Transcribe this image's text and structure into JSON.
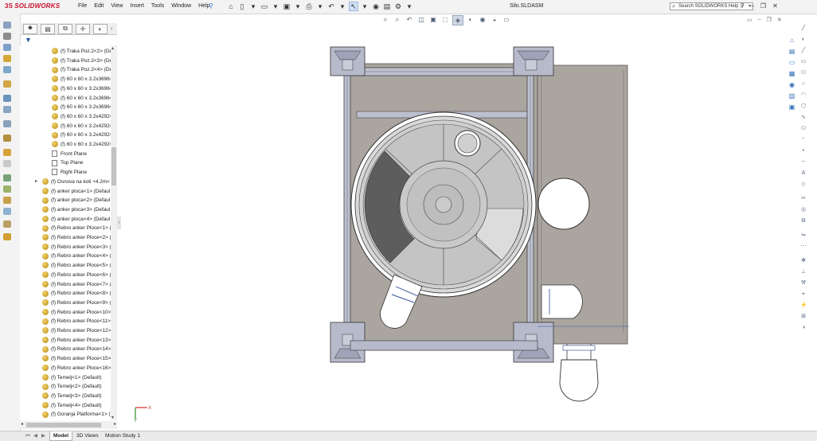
{
  "app": {
    "logo_text": "SOLIDWORKS",
    "logo_mark": "3S",
    "document_title": "Silo.SLDASM"
  },
  "menu": [
    "File",
    "Edit",
    "View",
    "Insert",
    "Tools",
    "Window",
    "Help"
  ],
  "search": {
    "placeholder": "Search SOLIDWORKS Help"
  },
  "feature_tree": {
    "items": [
      {
        "label": "(f) Traka Poz.2<2> (De",
        "kind": "part"
      },
      {
        "label": "(f) Traka Poz.2<3> (De",
        "kind": "part"
      },
      {
        "label": "(f) Traka Poz.2<4> (De",
        "kind": "part"
      },
      {
        "label": "(f) 60 x 60 x 3.2x3696<",
        "kind": "part"
      },
      {
        "label": "(f) 60 x 60 x 3.2x3696<",
        "kind": "part"
      },
      {
        "label": "(f) 60 x 60 x 3.2x3696<",
        "kind": "part"
      },
      {
        "label": "(f) 60 x 60 x 3.2x3696<",
        "kind": "part"
      },
      {
        "label": "(f) 60 x 60 x 3.2x4292<",
        "kind": "part"
      },
      {
        "label": "(f) 60 x 60 x 3.2x4292<",
        "kind": "part"
      },
      {
        "label": "(f) 60 x 60 x 3.2x4292<",
        "kind": "part"
      },
      {
        "label": "(f) 60 x 60 x 3.2x4292<",
        "kind": "part"
      },
      {
        "label": "Front Plane",
        "kind": "plane"
      },
      {
        "label": "Top Plane",
        "kind": "plane"
      },
      {
        "label": "Right Plane",
        "kind": "plane"
      },
      {
        "label": "(f) Osnova na koti +4.2m<",
        "kind": "assembly"
      },
      {
        "label": "(f) anker ploca<1> (Defaul",
        "kind": "part"
      },
      {
        "label": "(f) anker ploca<2> (Defaul",
        "kind": "part"
      },
      {
        "label": "(f) anker ploca<3> (Defaul",
        "kind": "part"
      },
      {
        "label": "(f) anker ploca<4> (Defaul",
        "kind": "part"
      },
      {
        "label": "(f) Rebro anker Ploce<1> (",
        "kind": "part"
      },
      {
        "label": "(f) Rebro anker Ploce<2> (",
        "kind": "part"
      },
      {
        "label": "(f) Rebro anker Ploce<3> (",
        "kind": "part"
      },
      {
        "label": "(f) Rebro anker Ploce<4> (",
        "kind": "part"
      },
      {
        "label": "(f) Rebro anker Ploce<5> (",
        "kind": "part"
      },
      {
        "label": "(f) Rebro anker Ploce<6> (",
        "kind": "part"
      },
      {
        "label": "(f) Rebro anker Ploce<7> (",
        "kind": "part"
      },
      {
        "label": "(f) Rebro anker Ploce<8> (",
        "kind": "part"
      },
      {
        "label": "(f) Rebro anker Ploce<9> (",
        "kind": "part"
      },
      {
        "label": "(f) Rebro anker Ploce<10>",
        "kind": "part"
      },
      {
        "label": "(f) Rebro anker Ploce<11>",
        "kind": "part"
      },
      {
        "label": "(f) Rebro anker Ploce<12>",
        "kind": "part"
      },
      {
        "label": "(f) Rebro anker Ploce<13>",
        "kind": "part"
      },
      {
        "label": "(f) Rebro anker Ploce<14>",
        "kind": "part"
      },
      {
        "label": "(f) Rebro anker Ploce<15>",
        "kind": "part"
      },
      {
        "label": "(f) Rebro anker Ploce<16>",
        "kind": "part"
      },
      {
        "label": "(f) Temelj<1> (Default)",
        "kind": "part"
      },
      {
        "label": "(f) Temelj<2> (Default)",
        "kind": "part"
      },
      {
        "label": "(f) Temelj<3> (Default)",
        "kind": "part"
      },
      {
        "label": "(f) Temelj<4> (Default)",
        "kind": "part"
      },
      {
        "label": "(f) Goranja Platforma<1> (",
        "kind": "part"
      }
    ]
  },
  "bottom_tabs": [
    "Model",
    "3D Views",
    "Motion Study 1"
  ],
  "triad": {
    "x_label": "X",
    "y_label": "Y"
  },
  "colors": {
    "accent": "#c8102e",
    "plate_fill": "#a9a59f",
    "frame_fill": "#b9bccb",
    "selection": "#cfe0f5"
  }
}
